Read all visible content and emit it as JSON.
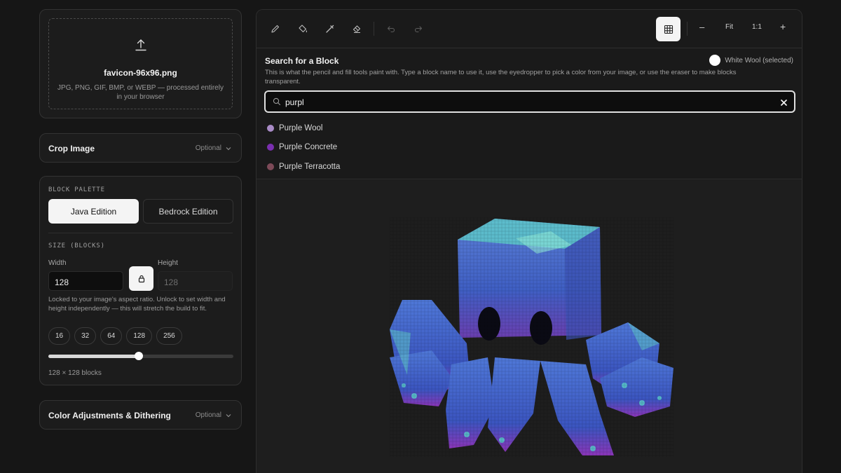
{
  "upload": {
    "file_name": "favicon-96x96.png",
    "hint": "JPG, PNG, GIF, BMP, or WEBP — processed entirely in your browser"
  },
  "crop": {
    "title": "Crop Image",
    "meta": "Optional"
  },
  "palette": {
    "section_label": "BLOCK PALETTE",
    "editions": [
      "Java Edition",
      "Bedrock Edition"
    ],
    "selected_edition": "Java Edition"
  },
  "size": {
    "section_label": "SIZE (BLOCKS)",
    "width_label": "Width",
    "height_label": "Height",
    "width_value": "128",
    "height_value": "128",
    "lock_note": "Locked to your image's aspect ratio. Unlock to set width and height independently — this will stretch the build to fit.",
    "presets": [
      "16",
      "32",
      "64",
      "128",
      "256"
    ],
    "slider_fraction": 0.49,
    "readout": "128 × 128 blocks"
  },
  "color_adjust": {
    "title": "Color Adjustments & Dithering",
    "meta": "Optional"
  },
  "toolbar": {
    "zoom_fit": "Fit",
    "zoom_actual": "1:1",
    "zoom_out": "–",
    "zoom_in": "+"
  },
  "search": {
    "title": "Search for a Block",
    "selected": "White Wool (selected)",
    "selected_color": "#ffffff",
    "description": "This is what the pencil and fill tools paint with. Type a block name to use it, use the eyedropper to pick a color from your image, or use the eraser to make blocks transparent.",
    "query": "purpl",
    "results": [
      {
        "name": "Purple Wool",
        "color": "#a98bc7"
      },
      {
        "name": "Purple Concrete",
        "color": "#7a2fb0"
      },
      {
        "name": "Purple Terracotta",
        "color": "#7d4a58"
      }
    ]
  }
}
